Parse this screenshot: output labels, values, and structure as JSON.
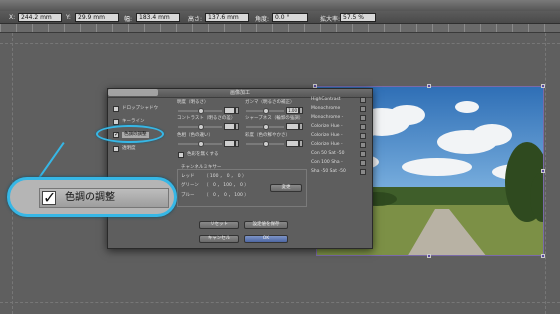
{
  "toolbar": {
    "x_label": "X:",
    "x_value": "244.2 mm",
    "y_label": "Y:",
    "y_value": "29.9 mm",
    "w_label": "幅:",
    "w_value": "183.4 mm",
    "h_label": "高さ:",
    "h_value": "137.6 mm",
    "angle_label": "角度:",
    "angle_value": "0.0 °",
    "scale_label": "拡大率:",
    "scale_value": "57.5 %"
  },
  "dialog": {
    "title": "画像加工",
    "options": [
      {
        "label": "ドロップシャドウ",
        "checked": false
      },
      {
        "label": "キーライン",
        "checked": false
      },
      {
        "label": "色調の調整",
        "checked": true
      },
      {
        "label": "透明度",
        "checked": false
      }
    ],
    "sliders": {
      "brightness_label": "明度（明るさ）",
      "gamma_label": "ガンマ（明るさの補正）",
      "gamma_value": "1.00",
      "contrast_label": "コントラスト（明るさの差）",
      "sharpness_label": "シャープネス（輪郭の強調）",
      "hue_label": "色相（色の違い）",
      "saturation_label": "彩度（色の鮮やかさ）"
    },
    "grayscale_label": "色彩を無くする",
    "channel_mixer": {
      "title": "チャンネルミキサー",
      "rows": [
        {
          "label": "レッド",
          "text": "（ 100 ，　0 ，　0 ）"
        },
        {
          "label": "グリーン",
          "text": "（　0 ， 100 ，　0 ）"
        },
        {
          "label": "ブルー",
          "text": "（　0 ，　0 ， 100 ）"
        }
      ],
      "change_button": "変更"
    },
    "presets": [
      "HighContrast",
      "Monochrome",
      "Monochrome -",
      "Colorize Hue -",
      "Colorize Hue -",
      "Colorize Hue -",
      "Con 50 Sat -50",
      "Con 100 Sha -",
      "Sha -50 Sat -50"
    ],
    "reset_button": "リセット",
    "save_preset_button": "設定値を保存",
    "cancel_button": "キャンセル",
    "ok_button": "OK"
  },
  "callout": {
    "label": "色調の調整"
  },
  "colors": {
    "accent": "#36b7e6",
    "ok_button": "#4d66a3",
    "selection": "#5a4aa0"
  }
}
